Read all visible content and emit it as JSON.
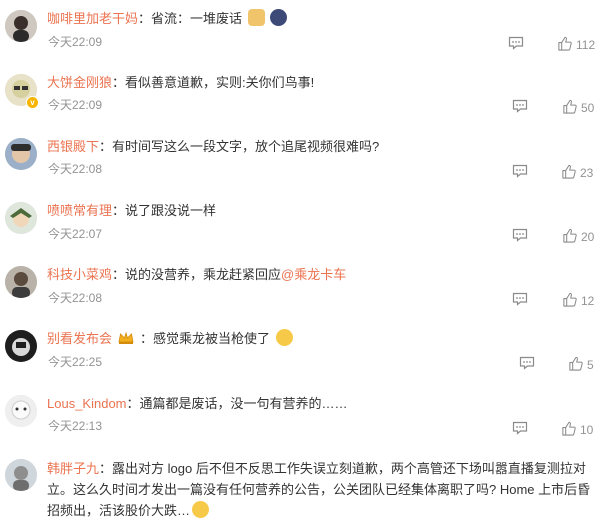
{
  "separator": "：",
  "comments": [
    {
      "user": "咖啡里加老干妈",
      "text": "省流：一堆废话",
      "time": "今天22:09",
      "likes": "112"
    },
    {
      "user": "大饼金刚狼",
      "text": "看似善意道歉，实则:关你们鸟事!",
      "time": "今天22:09",
      "likes": "50"
    },
    {
      "user": "西银殿下",
      "text": "有时间写这么一段文字，放个追尾视频很难吗?",
      "time": "今天22:08",
      "likes": "23"
    },
    {
      "user": "喷喷常有理",
      "text": "说了跟没说一样",
      "time": "今天22:07",
      "likes": "20"
    },
    {
      "user": "科技小菜鸡",
      "text": "说的没营养，乘龙赶紧回应",
      "mention": "@乘龙卡车",
      "time": "今天22:08",
      "likes": "12"
    },
    {
      "user": "别看发布会",
      "text": "感觉乘龙被当枪使了",
      "time": "今天22:25",
      "likes": "5"
    },
    {
      "user": "Lous_Kindom",
      "text": "通篇都是废话，没一句有营养的……",
      "time": "今天22:13",
      "likes": "10"
    },
    {
      "user": "韩胖子九",
      "text": "露出对方 logo 后不但不反思工作失误立刻道歉，两个高管还下场叫嚣直播复测拉对立。这么久时间才发出一篇没有任何营养的公告，公关团队已经集体离职了吗? Home 上市后昏招频出，活该股价大跌…"
    }
  ],
  "icons": {
    "reply": "comment-icon",
    "like": "thumbs-up-icon"
  },
  "colors": {
    "username": "#eb7350",
    "muted": "#939393",
    "text": "#333333"
  }
}
